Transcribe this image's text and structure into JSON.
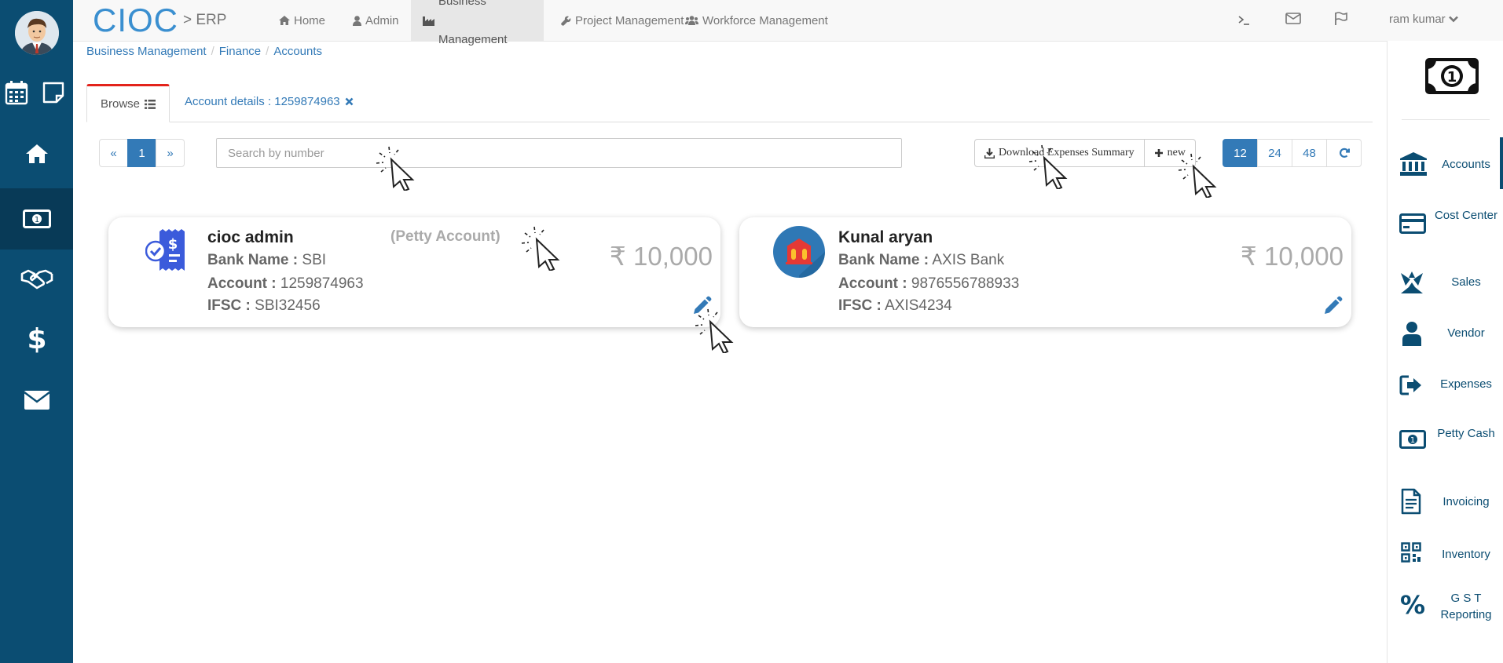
{
  "brand": {
    "name": "CIOC",
    "sub": "> ERP"
  },
  "topnav": [
    {
      "icon": "home-icon",
      "label": "Home"
    },
    {
      "icon": "user-icon",
      "label": "Admin"
    },
    {
      "icon": "industry-icon",
      "label": "Business Management",
      "active": true
    },
    {
      "icon": "wrench-icon",
      "label": "Project Management"
    },
    {
      "icon": "users-icon",
      "label": "Workforce Management"
    }
  ],
  "user": {
    "name": "ram kumar"
  },
  "breadcrumb": [
    "Business Management",
    "Finance",
    "Accounts"
  ],
  "tabs": {
    "browse": "Browse",
    "details": "Account details : 1259874963"
  },
  "pagination": {
    "prev": "«",
    "page": "1",
    "next": "»"
  },
  "search": {
    "placeholder": "Search by number"
  },
  "actions": {
    "download": "Download Expenses Summary",
    "new": "new"
  },
  "page_sizes": [
    "12",
    "24",
    "48"
  ],
  "accounts": [
    {
      "name": "cioc admin",
      "tag": "(Petty Account)",
      "bank_label": "Bank Name :",
      "bank": "SBI",
      "account_label": "Account :",
      "account": "1259874963",
      "ifsc_label": "IFSC :",
      "ifsc": "SBI32456",
      "amount": "₹ 10,000"
    },
    {
      "name": "Kunal aryan",
      "tag": "",
      "bank_label": "Bank Name :",
      "bank": "AXIS Bank",
      "account_label": "Account :",
      "account": "9876556788933",
      "ifsc_label": "IFSC :",
      "ifsc": "AXIS4234",
      "amount": "₹ 10,000"
    }
  ],
  "right_menu": [
    {
      "icon": "bank-icon",
      "label": "Accounts",
      "active": true
    },
    {
      "icon": "card-icon",
      "label": "Cost Center"
    },
    {
      "icon": "sales-icon",
      "label": "Sales"
    },
    {
      "icon": "vendor-icon",
      "label": "Vendor"
    },
    {
      "icon": "sign-out-icon",
      "label": "Expenses"
    },
    {
      "icon": "money-icon",
      "label": "Petty Cash"
    },
    {
      "icon": "invoice-icon",
      "label": "Invoicing"
    },
    {
      "icon": "qr-icon",
      "label": "Inventory"
    },
    {
      "icon": "percent-icon",
      "label": "G S T Reporting"
    }
  ],
  "colors": {
    "sidebar": "#0b4d72",
    "accent": "#337ab7",
    "tab_border": "#e3231b"
  }
}
